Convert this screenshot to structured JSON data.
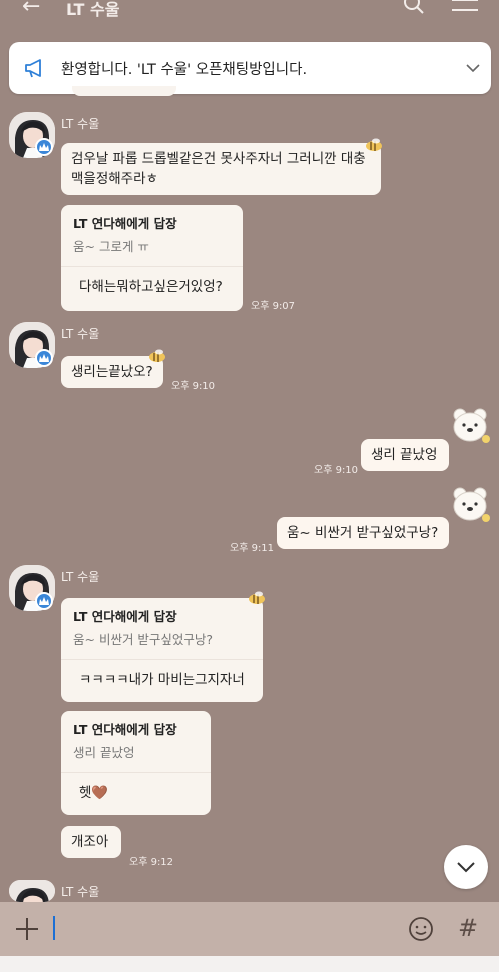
{
  "header": {
    "back_icon": "back-arrow-icon",
    "title": "LT 수울",
    "search_icon": "search-icon",
    "menu_icon": "hamburger-menu-icon"
  },
  "notice": {
    "icon": "megaphone-icon",
    "text": "환영합니다. 'LT 수울' 오픈채팅방입니다.",
    "toggle_icon": "chevron-down-icon"
  },
  "messages": [
    {
      "sender": "LT 수울",
      "text_line1": "검우날 파롭 드롭벨같은건 못사주자너 그러니깐 대충",
      "text_line2": "맥을정해주라ㅎ"
    },
    {
      "reply_to": "LT 연다해에게 답장",
      "quote": "움~ 그로게 ㅠ",
      "body": "다해는뭐하고싶은거있엉?",
      "time": "오후 9:07"
    },
    {
      "sender": "LT 수울",
      "text": "생리는끝났오?",
      "time": "오후 9:10"
    },
    {
      "text": "생리 끝났엉",
      "time": "오후 9:10"
    },
    {
      "text": "움~ 비싼거 받구싶었구낭?",
      "time": "오후 9:11"
    },
    {
      "sender": "LT 수울",
      "reply_to": "LT 연다해에게 답장",
      "quote": "움~ 비싼거 받구싶었구낭?",
      "body": "ㅋㅋㅋㅋ내가 마비는그지자너ㅋ"
    },
    {
      "reply_to": "LT 연다해에게 답장",
      "quote": "생리 끝났엉",
      "body": "헷🤎"
    },
    {
      "text": "개조아",
      "time": "오후 9:12"
    },
    {
      "sender": "LT 수울"
    }
  ],
  "scroll_button_icon": "chevron-down-icon",
  "composer": {
    "plus_icon": "plus-icon",
    "emoji_icon": "emoji-icon",
    "hash_label": "#"
  }
}
